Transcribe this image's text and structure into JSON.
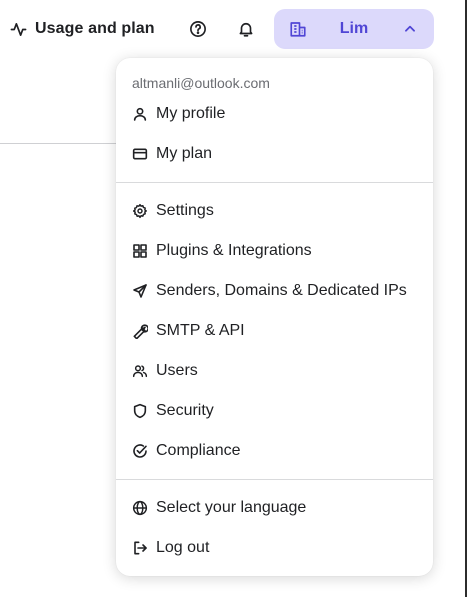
{
  "header": {
    "usage_label": "Usage and plan",
    "account_name": "Lim",
    "accent_bg": "#dcd9fb",
    "accent_text": "#5046d5"
  },
  "menu": {
    "email": "altmanli@outlook.com",
    "groups": [
      [
        {
          "label": "My profile",
          "icon": "user-icon"
        },
        {
          "label": "My plan",
          "icon": "credit-card-icon"
        }
      ],
      [
        {
          "label": "Settings",
          "icon": "gear-icon"
        },
        {
          "label": "Plugins & Integrations",
          "icon": "grid-icon"
        },
        {
          "label": "Senders, Domains & Dedicated IPs",
          "icon": "send-icon"
        },
        {
          "label": "SMTP & API",
          "icon": "wrench-icon"
        },
        {
          "label": "Users",
          "icon": "users-icon"
        },
        {
          "label": "Security",
          "icon": "shield-icon"
        },
        {
          "label": "Compliance",
          "icon": "check-circle-icon"
        }
      ],
      [
        {
          "label": "Select your language",
          "icon": "globe-icon"
        },
        {
          "label": "Log out",
          "icon": "logout-icon"
        }
      ]
    ]
  }
}
